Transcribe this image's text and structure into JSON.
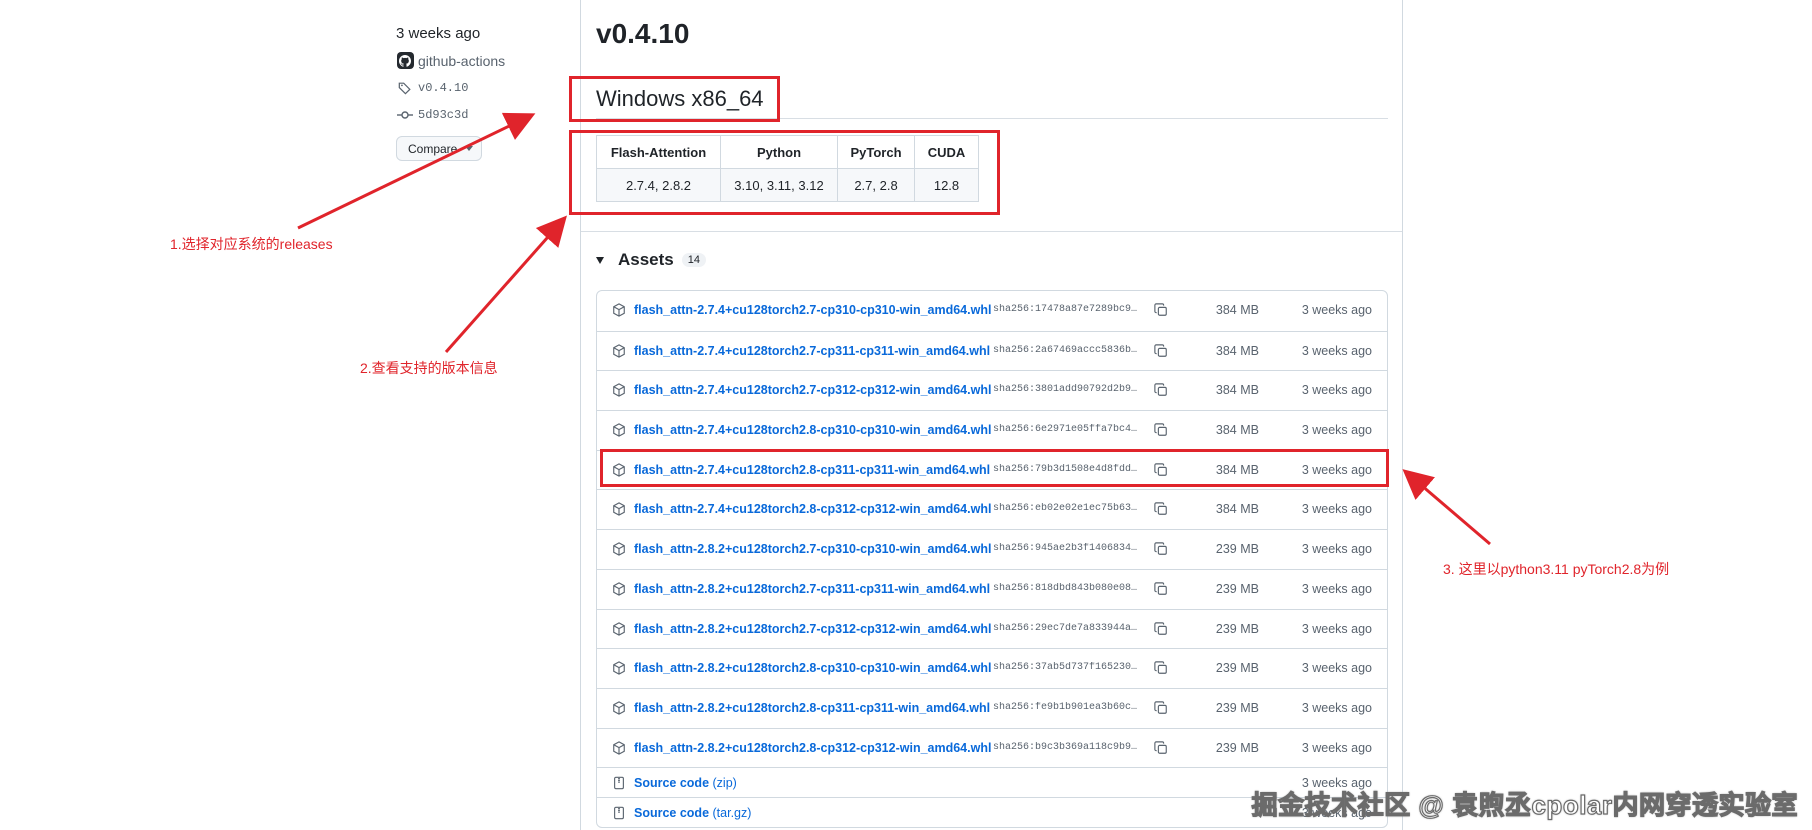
{
  "sidebar": {
    "time": "3 weeks ago",
    "author": "github-actions",
    "tag": "v0.4.10",
    "commit": "5d93c3d",
    "compare_label": "Compare"
  },
  "release": {
    "title": "v0.4.10",
    "platform": "Windows x86_64"
  },
  "compat_table": {
    "headers": [
      "Flash-Attention",
      "Python",
      "PyTorch",
      "CUDA"
    ],
    "row": [
      "2.7.4, 2.8.2",
      "3.10, 3.11, 3.12",
      "2.7, 2.8",
      "12.8"
    ]
  },
  "assets": {
    "label": "Assets",
    "count": "14",
    "items": [
      {
        "name": "flash_attn-2.7.4+cu128torch2.7-cp310-cp310-win_amd64.whl",
        "sha": "sha256:17478a87e7289bc9…",
        "size": "384 MB",
        "date": "3 weeks ago"
      },
      {
        "name": "flash_attn-2.7.4+cu128torch2.7-cp311-cp311-win_amd64.whl",
        "sha": "sha256:2a67469accc5836b…",
        "size": "384 MB",
        "date": "3 weeks ago"
      },
      {
        "name": "flash_attn-2.7.4+cu128torch2.7-cp312-cp312-win_amd64.whl",
        "sha": "sha256:3801add90792d2b9…",
        "size": "384 MB",
        "date": "3 weeks ago"
      },
      {
        "name": "flash_attn-2.7.4+cu128torch2.8-cp310-cp310-win_amd64.whl",
        "sha": "sha256:6e2971e05ffa7bc4…",
        "size": "384 MB",
        "date": "3 weeks ago"
      },
      {
        "name": "flash_attn-2.7.4+cu128torch2.8-cp311-cp311-win_amd64.whl",
        "sha": "sha256:79b3d1508e4d8fdd…",
        "size": "384 MB",
        "date": "3 weeks ago"
      },
      {
        "name": "flash_attn-2.7.4+cu128torch2.8-cp312-cp312-win_amd64.whl",
        "sha": "sha256:eb02e02e1ec75b63…",
        "size": "384 MB",
        "date": "3 weeks ago"
      },
      {
        "name": "flash_attn-2.8.2+cu128torch2.7-cp310-cp310-win_amd64.whl",
        "sha": "sha256:945ae2b3f1406834…",
        "size": "239 MB",
        "date": "3 weeks ago"
      },
      {
        "name": "flash_attn-2.8.2+cu128torch2.7-cp311-cp311-win_amd64.whl",
        "sha": "sha256:818dbd843b080e08…",
        "size": "239 MB",
        "date": "3 weeks ago"
      },
      {
        "name": "flash_attn-2.8.2+cu128torch2.7-cp312-cp312-win_amd64.whl",
        "sha": "sha256:29ec7de7a833944a…",
        "size": "239 MB",
        "date": "3 weeks ago"
      },
      {
        "name": "flash_attn-2.8.2+cu128torch2.8-cp310-cp310-win_amd64.whl",
        "sha": "sha256:37ab5d737f165230…",
        "size": "239 MB",
        "date": "3 weeks ago"
      },
      {
        "name": "flash_attn-2.8.2+cu128torch2.8-cp311-cp311-win_amd64.whl",
        "sha": "sha256:fe9b1b901ea3b60c…",
        "size": "239 MB",
        "date": "3 weeks ago"
      },
      {
        "name": "flash_attn-2.8.2+cu128torch2.8-cp312-cp312-win_amd64.whl",
        "sha": "sha256:b9c3b369a118c9b9…",
        "size": "239 MB",
        "date": "3 weeks ago"
      }
    ],
    "sources": [
      {
        "name": "Source code",
        "ext": "(zip)",
        "date": "3 weeks ago"
      },
      {
        "name": "Source code",
        "ext": "(tar.gz)",
        "date": "3 weeks ago"
      }
    ]
  },
  "annotations": {
    "step1": "1.选择对应系统的releases",
    "step2": "2.查看支持的版本信息",
    "step3": "3. 这里以python3.11  pyTorch2.8为例",
    "color": "#e0242b"
  },
  "watermark": "掘金技术社区 @ 袁煦丞cpolar内网穿透实验室",
  "colors": {
    "link": "#0969da",
    "muted": "#59636e",
    "border": "#d1d9e0"
  }
}
